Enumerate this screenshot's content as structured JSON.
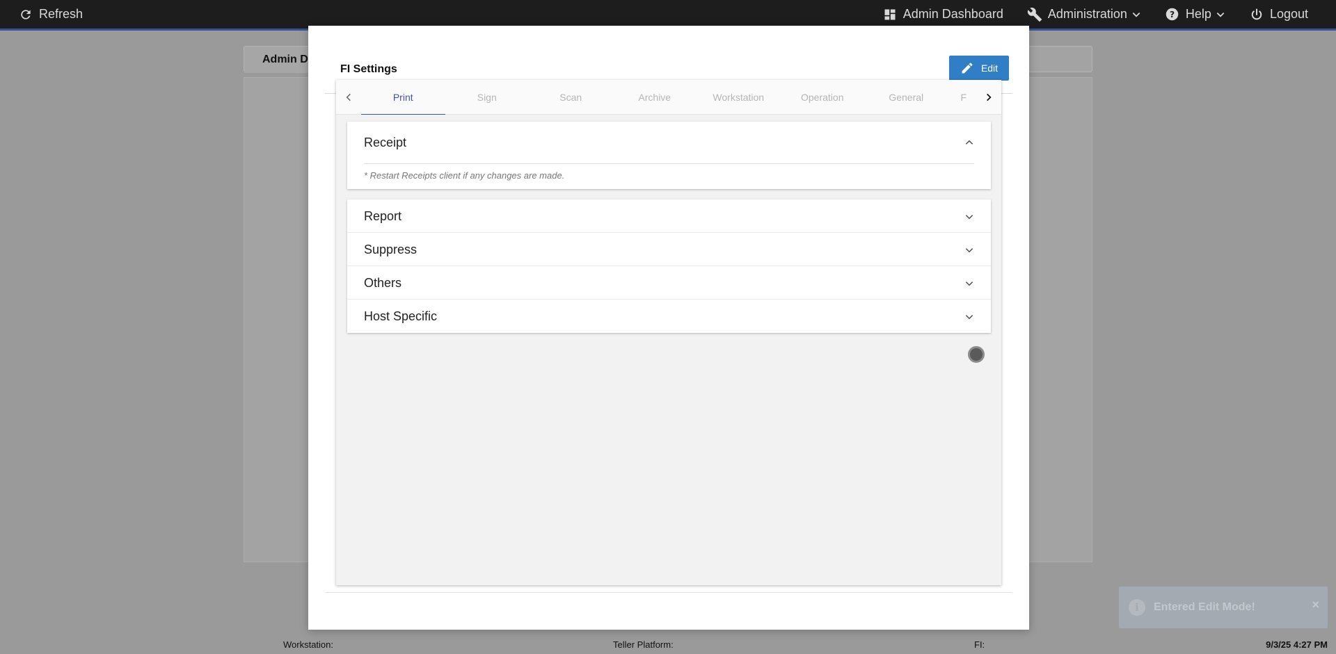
{
  "navbar": {
    "refresh_label": "Refresh",
    "admin_dashboard_label": "Admin Dashboard",
    "administration_label": "Administration",
    "help_label": "Help",
    "logout_label": "Logout"
  },
  "background": {
    "tab_label": "Admin D"
  },
  "modal": {
    "title": "FI Settings",
    "edit_label": "Edit",
    "tabs": [
      {
        "label": "Print",
        "active": true
      },
      {
        "label": "Sign",
        "active": false
      },
      {
        "label": "Scan",
        "active": false
      },
      {
        "label": "Archive",
        "active": false
      },
      {
        "label": "Workstation",
        "active": false
      },
      {
        "label": "Operation",
        "active": false
      },
      {
        "label": "General",
        "active": false
      },
      {
        "label": "F",
        "active": false
      }
    ],
    "expanded_panel": {
      "title": "Receipt",
      "note": "* Restart Receipts client if any changes are made."
    },
    "collapsed_panels": [
      {
        "title": "Report"
      },
      {
        "title": "Suppress"
      },
      {
        "title": "Others"
      },
      {
        "title": "Host Specific"
      }
    ]
  },
  "toast": {
    "message": "Entered Edit Mode!",
    "close_label": "×"
  },
  "statusbar": {
    "workstation_label": "Workstation:",
    "teller_platform_label": "Teller Platform:",
    "fi_label": "FI:",
    "datetime": "9/3/25 4:27 PM"
  },
  "colors": {
    "accent": "#3f51b5",
    "edit_button": "#2f7ec6",
    "navbar": "#1d1d1d"
  }
}
